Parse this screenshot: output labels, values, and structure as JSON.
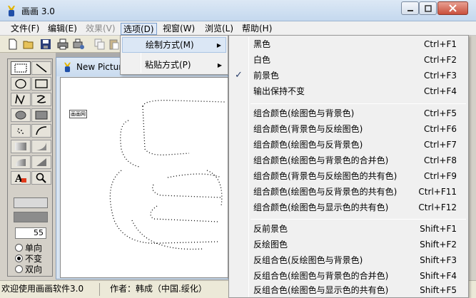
{
  "window": {
    "title": "画画 3.0"
  },
  "menubar": {
    "items": [
      {
        "label": "文件(F)",
        "state": "normal"
      },
      {
        "label": "编辑(E)",
        "state": "normal"
      },
      {
        "label": "效果(V)",
        "state": "disabled"
      },
      {
        "label": "选项(D)",
        "state": "active"
      },
      {
        "label": "视窗(W)",
        "state": "normal"
      },
      {
        "label": "浏览(L)",
        "state": "normal"
      },
      {
        "label": "帮助(H)",
        "state": "normal"
      }
    ]
  },
  "toolbar": {
    "icons": [
      "new-file-icon",
      "open-folder-icon",
      "save-icon",
      "print-icon",
      "print-setup-icon",
      "copy-icon",
      "paste-icon"
    ]
  },
  "palette": {
    "tools": [
      "rectangle-tool-icon",
      "line-tool-icon",
      "ellipse-tool-icon",
      "rounded-rect-tool-icon",
      "polyline-tool-icon",
      "freehand-tool-icon",
      "filled-ellipse-tool-icon",
      "filled-rect-tool-icon",
      "spray-tool-icon",
      "arc-tool-icon",
      "gradient-rect-tool-icon",
      "filled-polygon-tool-icon",
      "gradient-shape-tool-icon",
      "fill-tool-icon",
      "text-tool-icon",
      "zoom-tool-icon"
    ],
    "line_width": "55",
    "options": [
      {
        "label": "单向",
        "checked": false
      },
      {
        "label": "不变",
        "checked": true
      },
      {
        "label": "双向",
        "checked": false
      }
    ],
    "colors": {
      "foreground": "#d9d9d9",
      "background": "#8c8c8c"
    }
  },
  "child_window": {
    "title": "New Picture",
    "canvas_note": "画画网"
  },
  "options_menu": {
    "items": [
      {
        "label": "绘制方式(M)",
        "highlighted": true
      },
      {
        "label": "粘贴方式(P)",
        "highlighted": false
      }
    ]
  },
  "draw_mode_submenu": {
    "groups": [
      [
        {
          "label": "黑色",
          "shortcut": "Ctrl+F1",
          "checked": false
        },
        {
          "label": "白色",
          "shortcut": "Ctrl+F2",
          "checked": false
        },
        {
          "label": "前景色",
          "shortcut": "Ctrl+F3",
          "checked": true
        },
        {
          "label": "输出保持不变",
          "shortcut": "Ctrl+F4",
          "checked": false
        }
      ],
      [
        {
          "label": "组合颜色(绘图色与背景色)",
          "shortcut": "Ctrl+F5",
          "checked": false
        },
        {
          "label": "组合颜色(背景色与反绘图色)",
          "shortcut": "Ctrl+F6",
          "checked": false
        },
        {
          "label": "组合颜色(绘图色与反背景色)",
          "shortcut": "Ctrl+F7",
          "checked": false
        },
        {
          "label": "组合颜色(绘图色与背景色的合并色)",
          "shortcut": "Ctrl+F8",
          "checked": false
        },
        {
          "label": "组合颜色(背景色与反绘图色的共有色)",
          "shortcut": "Ctrl+F9",
          "checked": false
        },
        {
          "label": "组合颜色(绘图色与反背景色的共有色)",
          "shortcut": "Ctrl+F11",
          "checked": false
        },
        {
          "label": "组合颜色(绘图色与显示色的共有色)",
          "shortcut": "Ctrl+F12",
          "checked": false
        }
      ],
      [
        {
          "label": "反前景色",
          "shortcut": "Shift+F1",
          "checked": false
        },
        {
          "label": "反绘图色",
          "shortcut": "Shift+F2",
          "checked": false
        },
        {
          "label": "反组合色(反绘图色与背景色)",
          "shortcut": "Shift+F3",
          "checked": false
        },
        {
          "label": "反组合色(绘图色与背景色的合并色)",
          "shortcut": "Shift+F4",
          "checked": false
        },
        {
          "label": "反组合色(绘图色与显示色的共有色)",
          "shortcut": "Shift+F5",
          "checked": false
        }
      ]
    ]
  },
  "statusbar": {
    "message": "欢迎使用画画软件3.0",
    "author": "作者：韩成（中国.绥化）"
  }
}
